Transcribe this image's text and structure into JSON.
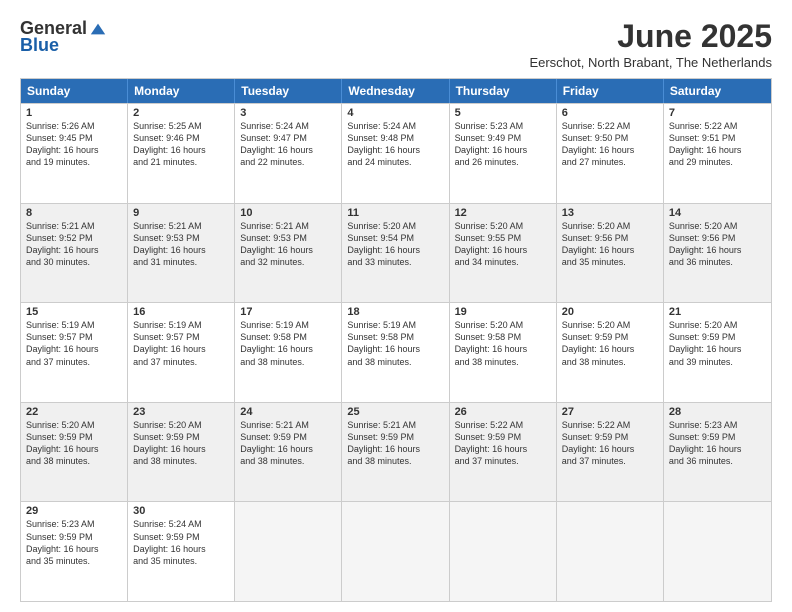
{
  "logo": {
    "general": "General",
    "blue": "Blue"
  },
  "title": "June 2025",
  "location": "Eerschot, North Brabant, The Netherlands",
  "days": [
    "Sunday",
    "Monday",
    "Tuesday",
    "Wednesday",
    "Thursday",
    "Friday",
    "Saturday"
  ],
  "rows": [
    [
      {
        "day": "1",
        "text": "Sunrise: 5:26 AM\nSunset: 9:45 PM\nDaylight: 16 hours\nand 19 minutes."
      },
      {
        "day": "2",
        "text": "Sunrise: 5:25 AM\nSunset: 9:46 PM\nDaylight: 16 hours\nand 21 minutes."
      },
      {
        "day": "3",
        "text": "Sunrise: 5:24 AM\nSunset: 9:47 PM\nDaylight: 16 hours\nand 22 minutes."
      },
      {
        "day": "4",
        "text": "Sunrise: 5:24 AM\nSunset: 9:48 PM\nDaylight: 16 hours\nand 24 minutes."
      },
      {
        "day": "5",
        "text": "Sunrise: 5:23 AM\nSunset: 9:49 PM\nDaylight: 16 hours\nand 26 minutes."
      },
      {
        "day": "6",
        "text": "Sunrise: 5:22 AM\nSunset: 9:50 PM\nDaylight: 16 hours\nand 27 minutes."
      },
      {
        "day": "7",
        "text": "Sunrise: 5:22 AM\nSunset: 9:51 PM\nDaylight: 16 hours\nand 29 minutes."
      }
    ],
    [
      {
        "day": "8",
        "text": "Sunrise: 5:21 AM\nSunset: 9:52 PM\nDaylight: 16 hours\nand 30 minutes."
      },
      {
        "day": "9",
        "text": "Sunrise: 5:21 AM\nSunset: 9:53 PM\nDaylight: 16 hours\nand 31 minutes."
      },
      {
        "day": "10",
        "text": "Sunrise: 5:21 AM\nSunset: 9:53 PM\nDaylight: 16 hours\nand 32 minutes."
      },
      {
        "day": "11",
        "text": "Sunrise: 5:20 AM\nSunset: 9:54 PM\nDaylight: 16 hours\nand 33 minutes."
      },
      {
        "day": "12",
        "text": "Sunrise: 5:20 AM\nSunset: 9:55 PM\nDaylight: 16 hours\nand 34 minutes."
      },
      {
        "day": "13",
        "text": "Sunrise: 5:20 AM\nSunset: 9:56 PM\nDaylight: 16 hours\nand 35 minutes."
      },
      {
        "day": "14",
        "text": "Sunrise: 5:20 AM\nSunset: 9:56 PM\nDaylight: 16 hours\nand 36 minutes."
      }
    ],
    [
      {
        "day": "15",
        "text": "Sunrise: 5:19 AM\nSunset: 9:57 PM\nDaylight: 16 hours\nand 37 minutes."
      },
      {
        "day": "16",
        "text": "Sunrise: 5:19 AM\nSunset: 9:57 PM\nDaylight: 16 hours\nand 37 minutes."
      },
      {
        "day": "17",
        "text": "Sunrise: 5:19 AM\nSunset: 9:58 PM\nDaylight: 16 hours\nand 38 minutes."
      },
      {
        "day": "18",
        "text": "Sunrise: 5:19 AM\nSunset: 9:58 PM\nDaylight: 16 hours\nand 38 minutes."
      },
      {
        "day": "19",
        "text": "Sunrise: 5:20 AM\nSunset: 9:58 PM\nDaylight: 16 hours\nand 38 minutes."
      },
      {
        "day": "20",
        "text": "Sunrise: 5:20 AM\nSunset: 9:59 PM\nDaylight: 16 hours\nand 38 minutes."
      },
      {
        "day": "21",
        "text": "Sunrise: 5:20 AM\nSunset: 9:59 PM\nDaylight: 16 hours\nand 39 minutes."
      }
    ],
    [
      {
        "day": "22",
        "text": "Sunrise: 5:20 AM\nSunset: 9:59 PM\nDaylight: 16 hours\nand 38 minutes."
      },
      {
        "day": "23",
        "text": "Sunrise: 5:20 AM\nSunset: 9:59 PM\nDaylight: 16 hours\nand 38 minutes."
      },
      {
        "day": "24",
        "text": "Sunrise: 5:21 AM\nSunset: 9:59 PM\nDaylight: 16 hours\nand 38 minutes."
      },
      {
        "day": "25",
        "text": "Sunrise: 5:21 AM\nSunset: 9:59 PM\nDaylight: 16 hours\nand 38 minutes."
      },
      {
        "day": "26",
        "text": "Sunrise: 5:22 AM\nSunset: 9:59 PM\nDaylight: 16 hours\nand 37 minutes."
      },
      {
        "day": "27",
        "text": "Sunrise: 5:22 AM\nSunset: 9:59 PM\nDaylight: 16 hours\nand 37 minutes."
      },
      {
        "day": "28",
        "text": "Sunrise: 5:23 AM\nSunset: 9:59 PM\nDaylight: 16 hours\nand 36 minutes."
      }
    ],
    [
      {
        "day": "29",
        "text": "Sunrise: 5:23 AM\nSunset: 9:59 PM\nDaylight: 16 hours\nand 35 minutes."
      },
      {
        "day": "30",
        "text": "Sunrise: 5:24 AM\nSunset: 9:59 PM\nDaylight: 16 hours\nand 35 minutes."
      },
      {
        "day": "",
        "text": ""
      },
      {
        "day": "",
        "text": ""
      },
      {
        "day": "",
        "text": ""
      },
      {
        "day": "",
        "text": ""
      },
      {
        "day": "",
        "text": ""
      }
    ]
  ]
}
